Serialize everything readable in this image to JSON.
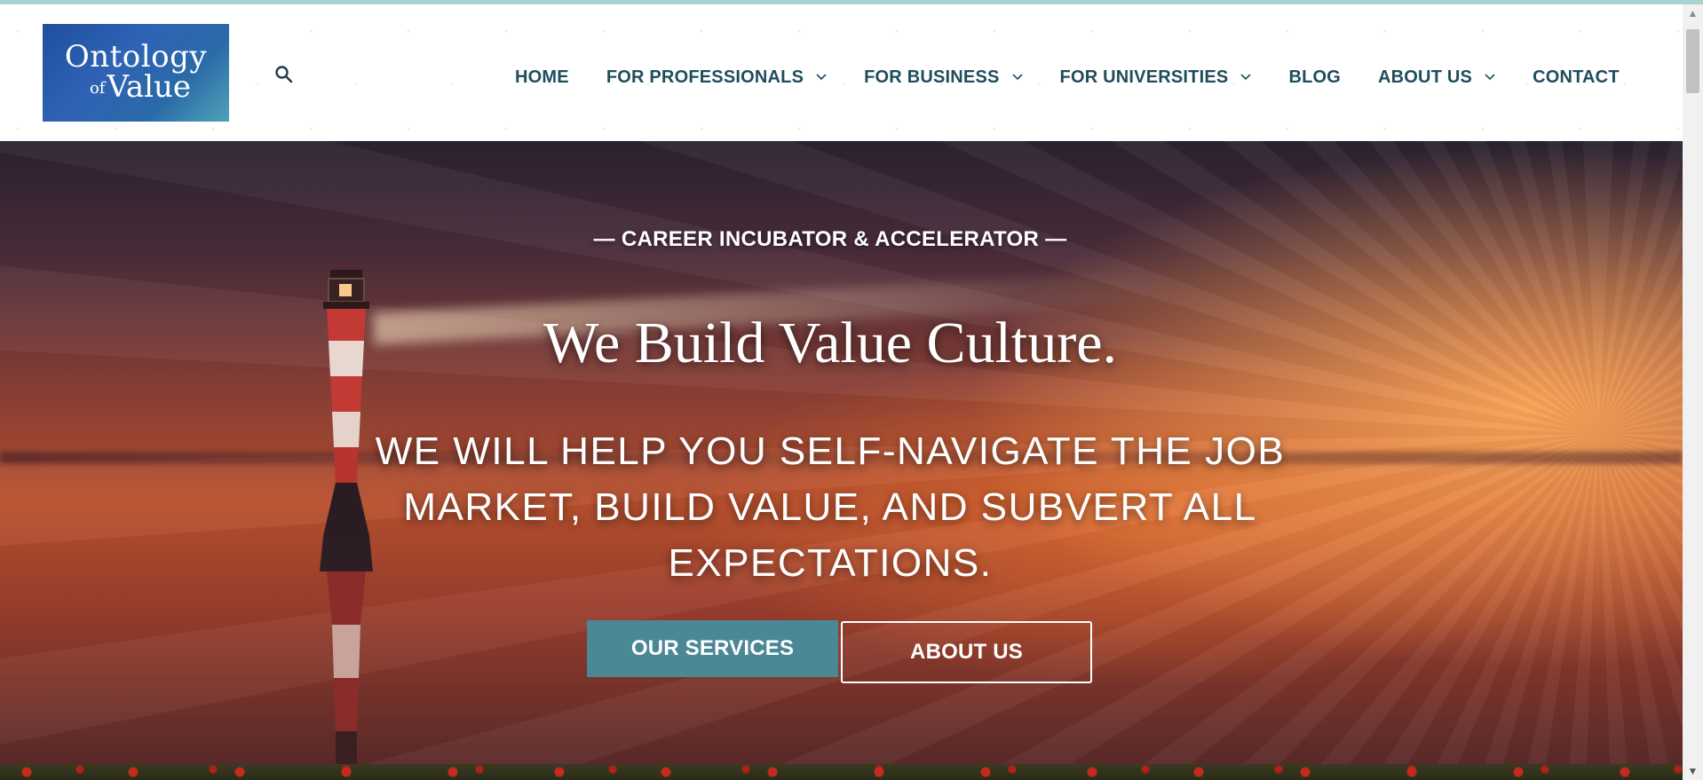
{
  "logo": {
    "line1": "Ontology",
    "of": "of",
    "line2": "Value"
  },
  "nav": {
    "items": [
      {
        "label": "HOME",
        "dropdown": false
      },
      {
        "label": "FOR PROFESSIONALS",
        "dropdown": true
      },
      {
        "label": "FOR BUSINESS",
        "dropdown": true
      },
      {
        "label": "FOR UNIVERSITIES",
        "dropdown": true
      },
      {
        "label": "BLOG",
        "dropdown": false
      },
      {
        "label": "ABOUT US",
        "dropdown": true
      },
      {
        "label": "CONTACT",
        "dropdown": false
      }
    ]
  },
  "hero": {
    "eyebrow": "— CAREER INCUBATOR & ACCELERATOR —",
    "headline": "We Build Value Culture.",
    "subhead": "WE WILL HELP YOU SELF-NAVIGATE THE JOB MARKET, BUILD VALUE, AND SUBVERT ALL EXPECTATIONS.",
    "primary_button": "OUR SERVICES",
    "secondary_button": "ABOUT US"
  },
  "colors": {
    "nav_text": "#1f4d5c",
    "primary_button": "#4a8896",
    "top_strip": "#a7d3d3"
  },
  "icons": {
    "search": "search-icon",
    "dropdown": "chevron-down-icon"
  }
}
